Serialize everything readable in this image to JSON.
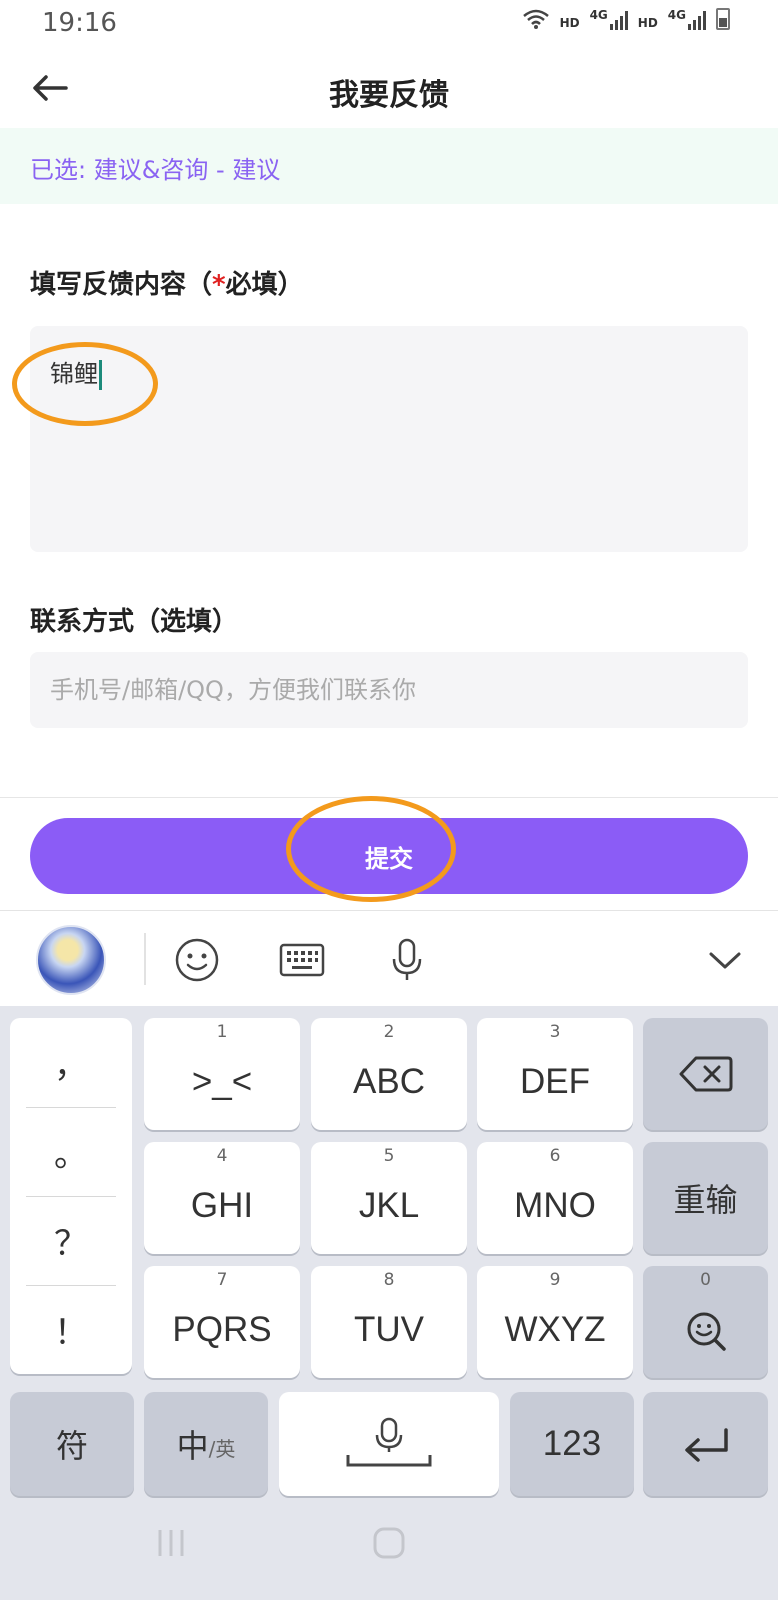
{
  "status_bar": {
    "time": "19:16",
    "hd_label": "HD",
    "net_label": "4G"
  },
  "nav": {
    "title": "我要反馈",
    "back_icon": "arrow-left-icon"
  },
  "selected_banner": {
    "text": "已选: 建议&咨询 - 建议"
  },
  "feedback": {
    "label_prefix": "填写反馈内容（",
    "required_mark": "*",
    "label_required": "必填",
    "label_suffix": "）",
    "value": "锦鲤"
  },
  "contact": {
    "label": "联系方式（选填）",
    "placeholder": "手机号/邮箱/QQ，方便我们联系你",
    "value": ""
  },
  "submit": {
    "label": "提交"
  },
  "keyboard_toolbar": {
    "icons": [
      "avatar",
      "emoji-icon",
      "keyboard-icon",
      "microphone-icon",
      "chevron-down-icon"
    ]
  },
  "keyboard": {
    "punctuation": [
      "，",
      "。",
      "？",
      "！"
    ],
    "keys": [
      {
        "num": "1",
        "label": ">_<"
      },
      {
        "num": "2",
        "label": "ABC"
      },
      {
        "num": "3",
        "label": "DEF"
      },
      {
        "num": "4",
        "label": "GHI"
      },
      {
        "num": "5",
        "label": "JKL"
      },
      {
        "num": "6",
        "label": "MNO"
      },
      {
        "num": "7",
        "label": "PQRS"
      },
      {
        "num": "8",
        "label": "TUV"
      },
      {
        "num": "9",
        "label": "WXYZ"
      }
    ],
    "reenter_label": "重输",
    "zero_num": "0",
    "symbol_label": "符",
    "lang_main": "中",
    "lang_sub": "/英",
    "num_label": "123"
  },
  "colors": {
    "accent": "#8b5cf6",
    "banner_bg": "#f1fbf6",
    "banner_text": "#8a63f2",
    "annotation": "#f39a1c",
    "required": "#e02020"
  }
}
